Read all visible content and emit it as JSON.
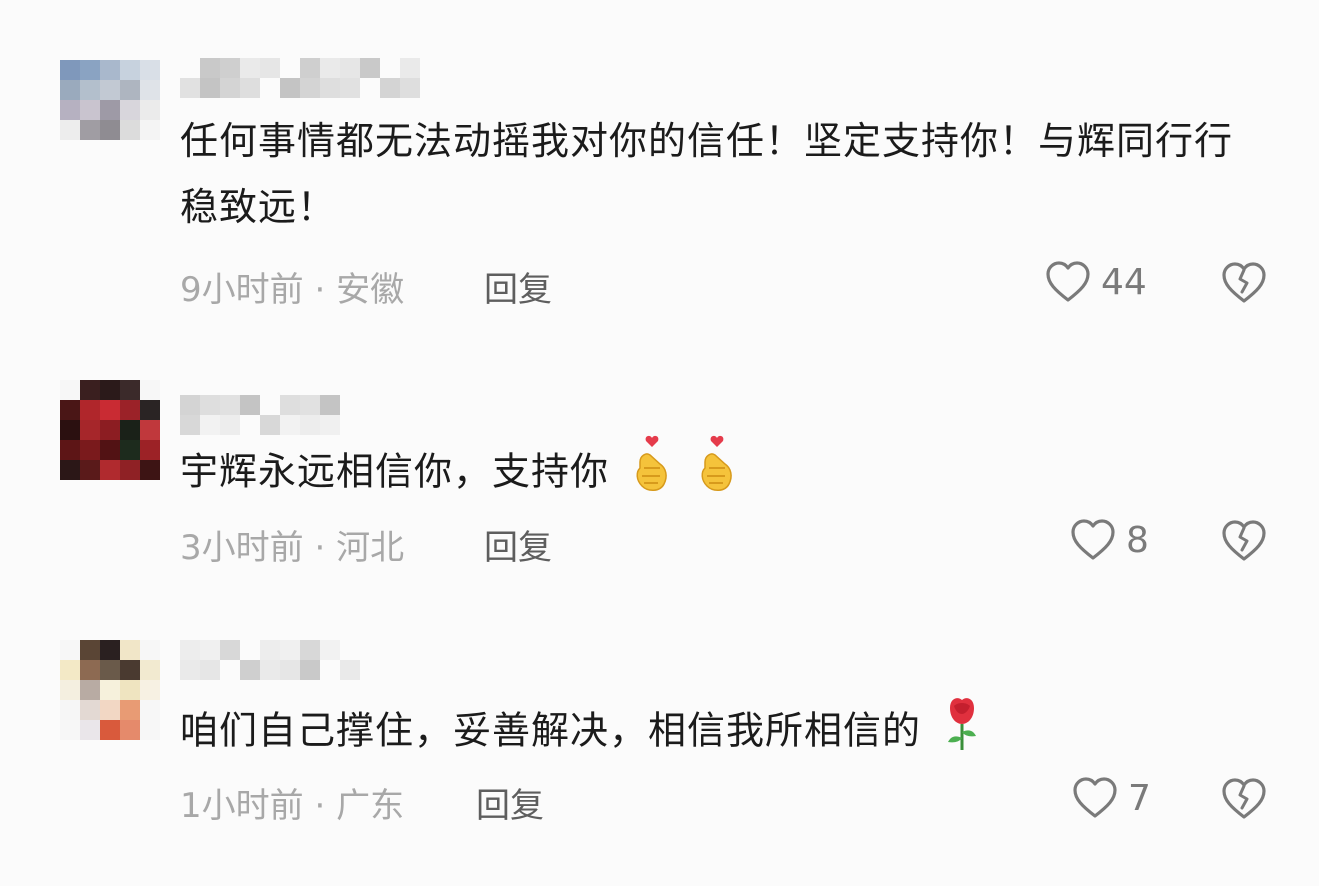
{
  "comments": [
    {
      "text": "任何事情都无法动摇我对你的信任！坚定支持你！与辉同行行稳致远！",
      "time": "9小时前",
      "location": "安徽",
      "separator": "·",
      "reply_label": "回复",
      "likes": "44",
      "emoji": [],
      "avatar_colors": [
        "#7f98bb",
        "#8aa3c2",
        "#a9b8cc",
        "#c7d2de",
        "#d9dfe7",
        "#9aaabd",
        "#b3bfcc",
        "#c2c9d3",
        "#aeb5c0",
        "#dfe3e8",
        "#b6b1c1",
        "#c9c4cf",
        "#9e9aa6",
        "#d8d6dc",
        "#ebebeb",
        "#ededed",
        "#a09da3",
        "#8f8c92",
        "#dcdcdc",
        "#f4f4f4"
      ]
    },
    {
      "text": "宇辉永远相信你，支持你",
      "time": "3小时前",
      "location": "河北",
      "separator": "·",
      "reply_label": "回复",
      "likes": "8",
      "emoji": [
        "finger-heart-icon",
        "finger-heart-icon"
      ],
      "avatar_colors": [
        "#f7f7f7",
        "#3a1f1f",
        "#2b1a1a",
        "#3b2a2a",
        "#f7f7f7",
        "#4a1616",
        "#b0262b",
        "#c92b33",
        "#9b2228",
        "#2a2424",
        "#2b1010",
        "#a6262a",
        "#8c1d22",
        "#1a2118",
        "#c0383c",
        "#5d1516",
        "#7a1a1c",
        "#521214",
        "#1d2b1d",
        "#9c2226",
        "#2b1717",
        "#5a1a1a",
        "#b02a2e",
        "#8f2125",
        "#3d1414"
      ]
    },
    {
      "text": "咱们自己撑住，妥善解决，相信我所相信的",
      "time": "1小时前",
      "location": "广东",
      "separator": "·",
      "reply_label": "回复",
      "likes": "7",
      "emoji": [
        "rose-icon"
      ],
      "avatar_colors": [
        "#f7f7f7",
        "#5a4535",
        "#2a2020",
        "#f1e6c8",
        "#f7f7f7",
        "#f3e9c6",
        "#8d6a52",
        "#6a5a4a",
        "#4a3a30",
        "#f2ead0",
        "#f4efe0",
        "#b8aba3",
        "#f6f1dc",
        "#efe4c0",
        "#f7f1e3",
        "#f6f6f6",
        "#e3d9d3",
        "#f2d7c4",
        "#e89b74",
        "#f7f7f7",
        "#f7f7f7",
        "#eae6ea",
        "#d95a3c",
        "#e58a6b",
        "#f7f7f7"
      ]
    }
  ],
  "colors": {
    "background": "#fbfbfb",
    "text": "#1b1b1b",
    "meta": "#a8a8a8",
    "reply": "#5e5e5e",
    "icon_stroke": "#7a7a7a"
  }
}
